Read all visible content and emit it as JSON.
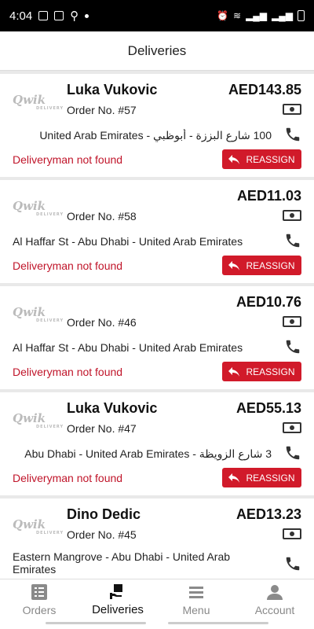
{
  "status_bar": {
    "time": "4:04"
  },
  "appbar": {
    "title": "Deliveries"
  },
  "orders": [
    {
      "name": "Luka Vukovic",
      "order_no": "Order No. #57",
      "price": "AED143.85",
      "address": "100 شارع البززة - أبوظبي - United Arab Emirates",
      "rtl": true,
      "status": "Deliveryman not found",
      "action": "REASSIGN"
    },
    {
      "name": "",
      "order_no": "Order No. #58",
      "price": "AED11.03",
      "address": "Al Haffar St - Abu Dhabi - United Arab Emirates",
      "rtl": false,
      "status": "Deliveryman not found",
      "action": "REASSIGN"
    },
    {
      "name": "",
      "order_no": "Order No. #46",
      "price": "AED10.76",
      "address": "Al Haffar St - Abu Dhabi - United Arab Emirates",
      "rtl": false,
      "status": "Deliveryman not found",
      "action": "REASSIGN"
    },
    {
      "name": "Luka Vukovic",
      "order_no": "Order No. #47",
      "price": "AED55.13",
      "address": "3 شارع الزويظة - Abu Dhabi - United Arab Emirates",
      "rtl": true,
      "status": "Deliveryman not found",
      "action": "REASSIGN"
    },
    {
      "name": "Dino Dedic",
      "order_no": "Order No. #45",
      "price": "AED13.23",
      "address": "Eastern Mangrove - Abu Dhabi - United Arab Emirates",
      "rtl": false,
      "status": "",
      "action": ""
    }
  ],
  "logo_text": "Qwik",
  "logo_sub": "DELIVERY",
  "nav": [
    {
      "label": "Orders",
      "icon": "orders-icon",
      "active": false
    },
    {
      "label": "Deliveries",
      "icon": "deliveries-icon",
      "active": true
    },
    {
      "label": "Menu",
      "icon": "menu-icon",
      "active": false
    },
    {
      "label": "Account",
      "icon": "account-icon",
      "active": false
    }
  ],
  "colors": {
    "accent": "#d11a2a",
    "status_text": "#c0152a"
  }
}
